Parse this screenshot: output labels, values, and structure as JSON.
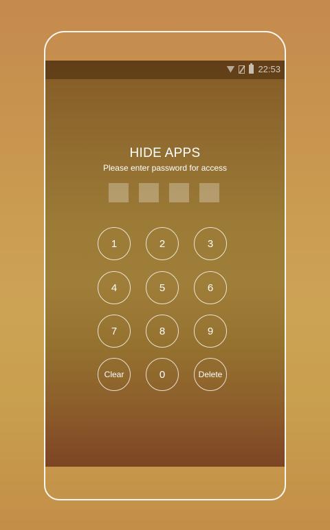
{
  "status_bar": {
    "time": "22:53",
    "icons": [
      "wifi-icon",
      "no-sim-icon",
      "battery-icon"
    ]
  },
  "lock": {
    "title": "HIDE APPS",
    "subtitle": "Please enter password for access",
    "pin_length": 4
  },
  "keypad": {
    "k1": "1",
    "k2": "2",
    "k3": "3",
    "k4": "4",
    "k5": "5",
    "k6": "6",
    "k7": "7",
    "k8": "8",
    "k9": "9",
    "clear": "Clear",
    "k0": "0",
    "delete": "Delete"
  },
  "colors": {
    "background_top": "#c48a4e",
    "screen_top": "#845a25",
    "screen_bottom": "#7d4424",
    "foreground": "#ffffff"
  }
}
